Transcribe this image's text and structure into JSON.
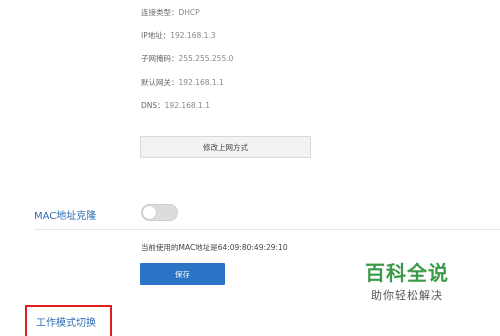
{
  "wan_info": {
    "conn_type_label": "连接类型：",
    "conn_type_value": "DHCP",
    "ip_label": "IP地址：",
    "ip_value": "192.168.1.3",
    "mask_label": "子网掩码：",
    "mask_value": "255.255.255.0",
    "gateway_label": "默认网关：",
    "gateway_value": "192.168.1.1",
    "dns_label": "DNS：",
    "dns_value": "192.168.1.1",
    "change_button": "修改上网方式"
  },
  "mac_clone": {
    "title": "MAC地址克隆",
    "toggle_state": "off",
    "current_mac_text": "当前使用的MAC地址是64:09:80:49:29:10",
    "save_button": "保存"
  },
  "work_mode": {
    "title": "工作模式切换"
  },
  "watermark": {
    "main": "百科全说",
    "sub": "助你轻松解决"
  },
  "colors": {
    "link_blue": "#2f6db5",
    "save_blue": "#2b73c4",
    "highlight_red": "#e02020",
    "watermark_green": "#3b9a48"
  }
}
